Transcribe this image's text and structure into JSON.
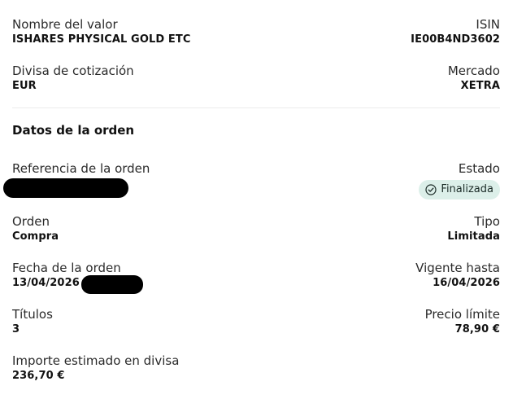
{
  "instrument": {
    "name_label": "Nombre del valor",
    "name_value": "ISHARES PHYSICAL GOLD ETC",
    "isin_label": "ISIN",
    "isin_value": "IE00B4ND3602",
    "currency_label": "Divisa de cotización",
    "currency_value": "EUR",
    "market_label": "Mercado",
    "market_value": "XETRA"
  },
  "order": {
    "section_title": "Datos de la orden",
    "reference_label": "Referencia de la orden",
    "status_label": "Estado",
    "status_value": "Finalizada",
    "status_icon": "check-circle-icon",
    "status_color": "#dcefe9",
    "type_label": "Orden",
    "type_value": "Compra",
    "kind_label": "Tipo",
    "kind_value": "Limitada",
    "date_label": "Fecha de la orden",
    "date_value": "13/04/2026",
    "valid_label": "Vigente hasta",
    "valid_value": "16/04/2026",
    "shares_label": "Títulos",
    "shares_value": "3",
    "limit_label": "Precio límite",
    "limit_value": "78,90 €",
    "estimate_label": "Importe estimado en divisa",
    "estimate_value": "236,70 €"
  }
}
